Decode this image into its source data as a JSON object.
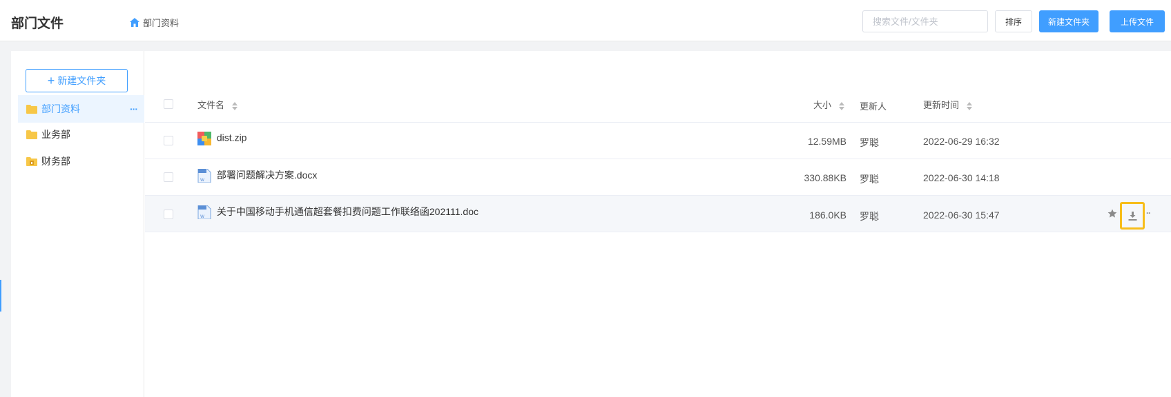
{
  "header": {
    "title": "部门文件",
    "breadcrumb": "部门资料",
    "search_placeholder": "搜索文件/文件夹",
    "sort_label": "排序",
    "new_folder_label": "新建文件夹",
    "upload_label": "上传文件"
  },
  "sidebar": {
    "new_folder_label": "新建文件夹",
    "items": [
      {
        "label": "部门资料",
        "icon": "folder-icon",
        "active": true
      },
      {
        "label": "业务部",
        "icon": "folder-icon"
      },
      {
        "label": "财务部",
        "icon": "folder-locked-icon"
      }
    ]
  },
  "table": {
    "columns": {
      "name": "文件名",
      "size": "大小",
      "updater": "更新人",
      "updated_at": "更新时间"
    },
    "rows": [
      {
        "name": "dist.zip",
        "icon": "zip-file-icon",
        "size": "12.59MB",
        "updater": "罗聪",
        "updated_at": "2022-06-29 16:32"
      },
      {
        "name": "部署问题解决方案.docx",
        "icon": "word-file-icon",
        "size": "330.88KB",
        "updater": "罗聪",
        "updated_at": "2022-06-30 14:18"
      },
      {
        "name": "关于中国移动手机通信超套餐扣费问题工作联络函202111.doc",
        "icon": "word-file-icon",
        "size": "186.0KB",
        "updater": "罗聪",
        "updated_at": "2022-06-30 15:47"
      }
    ]
  },
  "colors": {
    "accent": "#409eff",
    "highlight": "#f7bd1a"
  }
}
